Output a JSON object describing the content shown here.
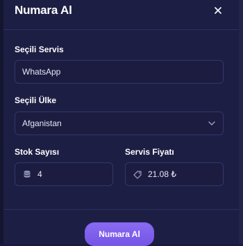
{
  "modal": {
    "title": "Numara Al"
  },
  "service": {
    "label": "Seçili Servis",
    "value": "WhatsApp"
  },
  "country": {
    "label": "Seçili Ülke",
    "value": "Afganistan"
  },
  "stock": {
    "label": "Stok Sayısı",
    "value": "4",
    "icon": "database-icon"
  },
  "price": {
    "label": "Servis Fiyatı",
    "value": "21.08 ₺",
    "icon": "price-tag-icon"
  },
  "actions": {
    "submit_label": "Numara Al"
  },
  "colors": {
    "background": "#1a1b3c",
    "modal": "#1d1e44",
    "input_border": "#34376a",
    "accent": "#7b5cec"
  }
}
